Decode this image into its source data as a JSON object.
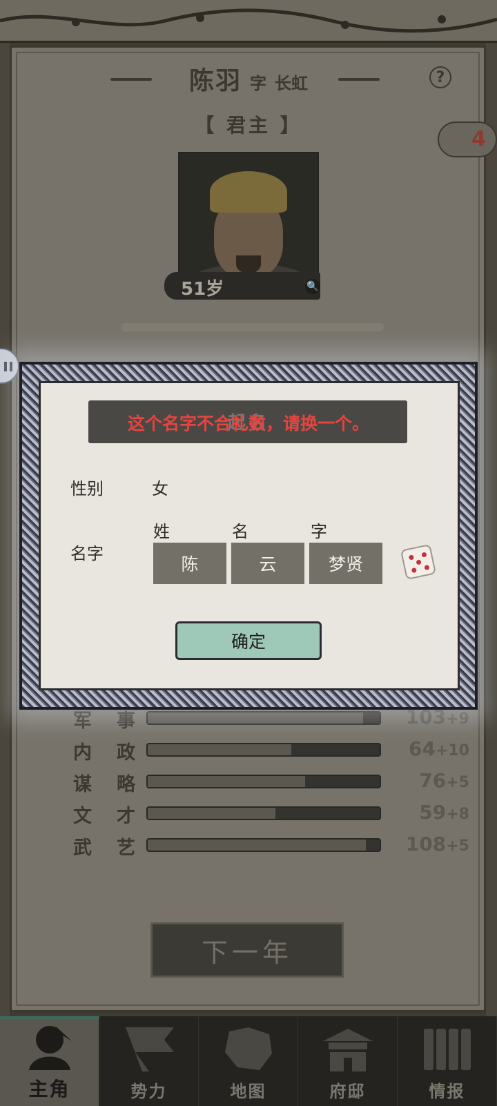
{
  "header": {
    "name": "陈羽",
    "zi_label": "字",
    "courtesy_name": "长虹",
    "help": "?",
    "role": "【 君主 】",
    "badge_count": "4"
  },
  "portrait": {
    "age": "51岁"
  },
  "dialog": {
    "title": "起名",
    "error_message": "这个名字不合礼数，请换一个。",
    "gender_label": "性别",
    "gender_value": "女",
    "name_label": "名字",
    "col_surname": "姓",
    "col_given": "名",
    "col_courtesy": "字",
    "surname": "陈",
    "given_name": "云",
    "courtesy": "梦贤",
    "confirm_label": "确定"
  },
  "stats": [
    {
      "label_a": "军",
      "label_b": "事",
      "value": "103",
      "bonus": "+9",
      "fill": 0.93
    },
    {
      "label_a": "内",
      "label_b": "政",
      "value": "64",
      "bonus": "+10",
      "fill": 0.62
    },
    {
      "label_a": "谋",
      "label_b": "略",
      "value": "76",
      "bonus": "+5",
      "fill": 0.68
    },
    {
      "label_a": "文",
      "label_b": "才",
      "value": "59",
      "bonus": "+8",
      "fill": 0.55
    },
    {
      "label_a": "武",
      "label_b": "艺",
      "value": "108",
      "bonus": "+5",
      "fill": 0.94
    }
  ],
  "next_year_label": "下一年",
  "nav": [
    {
      "label": "主角",
      "icon": "hero-icon",
      "active": true
    },
    {
      "label": "势力",
      "icon": "flag-icon",
      "active": false
    },
    {
      "label": "地图",
      "icon": "map-icon",
      "active": false
    },
    {
      "label": "府邸",
      "icon": "mansion-icon",
      "active": false
    },
    {
      "label": "情报",
      "icon": "scroll-icon",
      "active": false
    }
  ],
  "colors": {
    "error": "#e8433e",
    "confirm": "#9ec8b8",
    "panel": "#77736a"
  }
}
